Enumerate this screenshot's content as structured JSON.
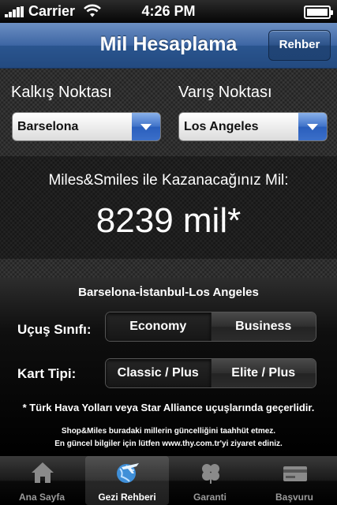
{
  "status_bar": {
    "carrier": "Carrier",
    "time": "4:26 PM"
  },
  "nav": {
    "title": "Mil Hesaplama",
    "right_button": "Rehber"
  },
  "form": {
    "departure_label": "Kalkış Noktası",
    "departure_value": "Barselona",
    "arrival_label": "Varış Noktası",
    "arrival_value": "Los Angeles"
  },
  "result": {
    "label": "Miles&Smiles ile Kazanacağınız Mil:",
    "value": "8239 mil*"
  },
  "route": "Barselona-İstanbul-Los Angeles",
  "flight_class": {
    "label": "Uçuş Sınıfı:",
    "options": [
      "Economy",
      "Business"
    ],
    "selected": "Economy"
  },
  "card_type": {
    "label": "Kart Tipi:",
    "options": [
      "Classic / Plus",
      "Elite / Plus"
    ],
    "selected": "Classic / Plus"
  },
  "notes": {
    "validity": "* Türk Hava Yolları veya Star Alliance uçuşlarında geçerlidir.",
    "disclaimer_1": "Shop&Miles buradaki millerin güncelliğini taahhüt etmez.",
    "disclaimer_2": "En güncel bilgiler için lütfen www.thy.com.tr'yi ziyaret ediniz."
  },
  "tabs": [
    {
      "label": "Ana Sayfa",
      "icon": "home-icon"
    },
    {
      "label": "Gezi Rehberi",
      "icon": "globe-plane-icon"
    },
    {
      "label": "Garanti",
      "icon": "clover-icon"
    },
    {
      "label": "Başvuru",
      "icon": "card-icon"
    }
  ],
  "colors": {
    "nav_blue": "#3d66a4",
    "select_accent": "#2a5fbd"
  }
}
